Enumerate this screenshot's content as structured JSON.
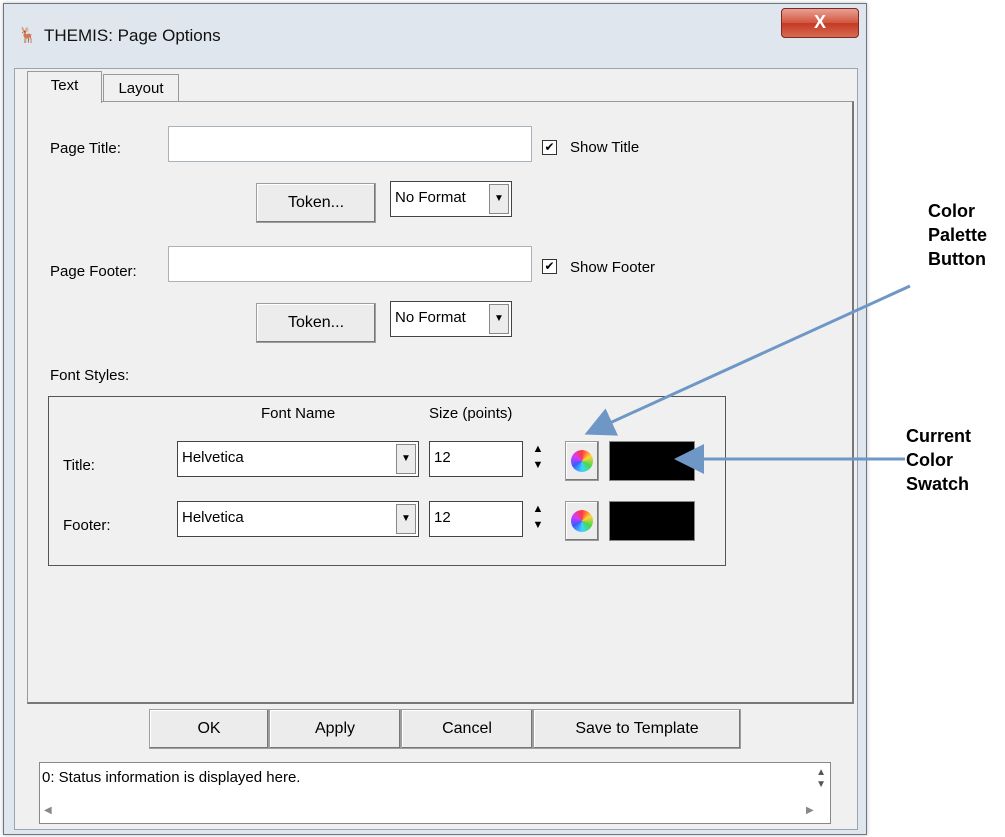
{
  "window": {
    "title": "THEMIS: Page Options",
    "close_label": "X",
    "icon": "themis-logo-icon"
  },
  "tabs": [
    {
      "label": "Text",
      "active": true
    },
    {
      "label": "Layout",
      "active": false
    }
  ],
  "page_title": {
    "label": "Page Title:",
    "value": "",
    "show_label": "Show Title",
    "checked": true,
    "token_label": "Token...",
    "format_value": "No Format"
  },
  "page_footer": {
    "label": "Page Footer:",
    "value": "",
    "show_label": "Show Footer",
    "checked": true,
    "token_label": "Token...",
    "format_value": "No Format"
  },
  "font_styles": {
    "label": "Font Styles:",
    "header_font_name": "Font Name",
    "header_size": "Size (points)",
    "rows": [
      {
        "label": "Title:",
        "font": "Helvetica",
        "size": "12",
        "color": "#000000"
      },
      {
        "label": "Footer:",
        "font": "Helvetica",
        "size": "12",
        "color": "#000000"
      }
    ]
  },
  "buttons": {
    "ok": "OK",
    "apply": "Apply",
    "cancel": "Cancel",
    "save_template": "Save to Template"
  },
  "status": {
    "text": "0: Status information is displayed here."
  },
  "annotations": {
    "palette_label": "Color Palette Button",
    "swatch_label": "Current Color Swatch",
    "arrow_color": "#6f97c6"
  }
}
